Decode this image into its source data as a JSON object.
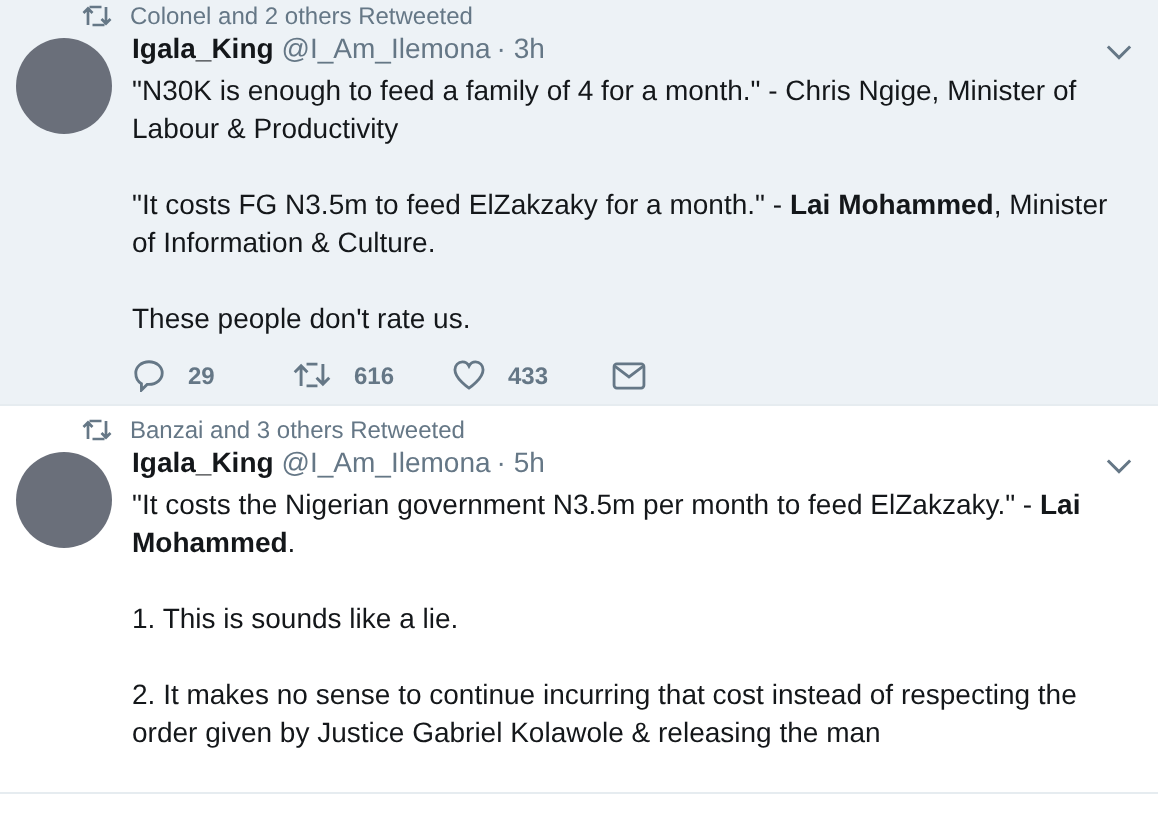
{
  "tweets": [
    {
      "retweeted_by": "Colonel and 2 others Retweeted",
      "name": "Igala_King",
      "handle": "@I_Am_Ilemona",
      "time": "· 3h",
      "highlighted": true,
      "paragraphs": [
        "\"N30K is enough to feed a family of 4 for a month.\" - Chris Ngige, Minister of Labour & Productivity",
        "\"It costs FG N3.5m to feed ElZakzaky for a month.\" - **Lai Mohammed**, Minister of Information & Culture.",
        "These people don't rate us."
      ],
      "actions": {
        "replies": "29",
        "retweets": "616",
        "likes": "433"
      }
    },
    {
      "retweeted_by": "Banzai and 3 others Retweeted",
      "name": "Igala_King",
      "handle": "@I_Am_Ilemona",
      "time": "· 5h",
      "highlighted": false,
      "paragraphs": [
        "\"It costs the Nigerian government N3.5m per month to feed ElZakzaky.\" - **Lai Mohammed**.",
        "1. This is sounds like a lie.",
        "2. It makes no sense to continue incurring that cost instead of respecting the order given by Justice Gabriel Kolawole & releasing the man"
      ]
    }
  ]
}
